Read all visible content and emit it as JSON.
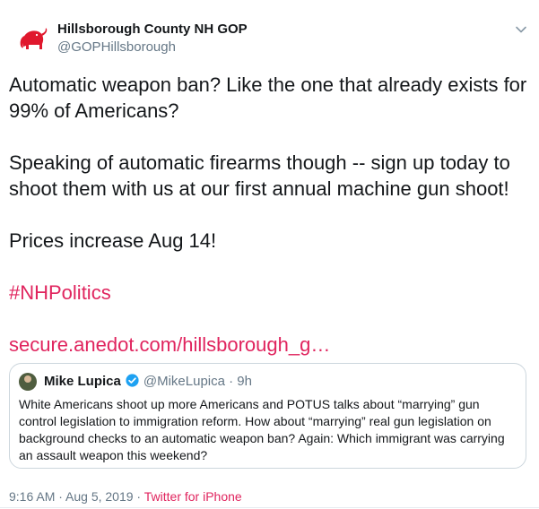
{
  "author": {
    "name": "Hillsborough County NH GOP",
    "handle": "@GOPHillsborough",
    "avatar_icon": "red-elephant-logo-icon"
  },
  "tweet": {
    "paragraphs": [
      "Automatic weapon ban? Like the one that already exists for 99% of Americans?",
      "Speaking of automatic firearms though -- sign up today to shoot them with us at our first annual machine gun shoot!",
      "Prices increase Aug 14!"
    ],
    "hashtag": "#NHPolitics",
    "link": "secure.anedot.com/hillsborough_g…"
  },
  "quoted": {
    "name": "Mike Lupica",
    "handle": "@MikeLupica",
    "time": "· 9h",
    "text": "White Americans shoot up more Americans and POTUS  talks about “marrying” gun control legislation to immigration reform. How about “marrying” real gun legislation on background checks to an automatic weapon ban?  Again: Which immigrant was carrying an assault weapon this weekend?"
  },
  "meta": {
    "timestamp": "9:16 AM · Aug 5, 2019 ·",
    "source": "Twitter for iPhone"
  },
  "colors": {
    "accent": "#e0245e",
    "muted": "#657786",
    "text": "#14171a",
    "verified": "#1da1f2",
    "elephant": "#e0182d"
  }
}
